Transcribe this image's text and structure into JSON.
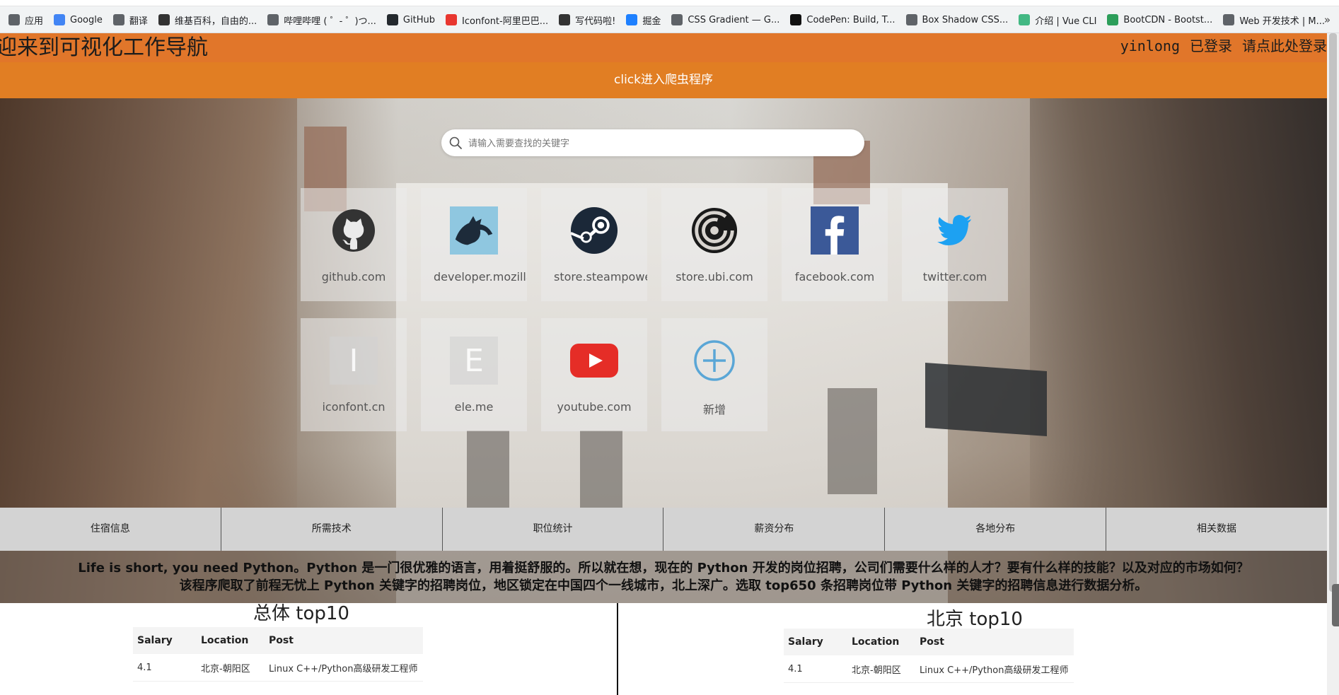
{
  "bookmarks": [
    {
      "label": "应用",
      "icon": "apps-grid-icon",
      "color": "#5f6368"
    },
    {
      "label": "Google",
      "icon": "google-icon",
      "color": "#4285f4"
    },
    {
      "label": "翻译",
      "icon": "translate-icon",
      "color": "#5f6368"
    },
    {
      "label": "维基百科，自由的...",
      "icon": "wikipedia-icon",
      "color": "#333333"
    },
    {
      "label": "哔哩哔哩 ( ゜- ゜)つ...",
      "icon": "globe-icon",
      "color": "#5f6368"
    },
    {
      "label": "GitHub",
      "icon": "github-icon",
      "color": "#24292e"
    },
    {
      "label": "Iconfont-阿里巴巴...",
      "icon": "iconfont-icon",
      "color": "#e8362f"
    },
    {
      "label": "写代码啦!",
      "icon": "code-icon",
      "color": "#333333"
    },
    {
      "label": "掘金",
      "icon": "juejin-icon",
      "color": "#1e80ff"
    },
    {
      "label": "CSS Gradient — G...",
      "icon": "globe-icon",
      "color": "#5f6368"
    },
    {
      "label": "CodePen: Build, T...",
      "icon": "codepen-icon",
      "color": "#111111"
    },
    {
      "label": "Box Shadow CSS...",
      "icon": "globe-icon",
      "color": "#5f6368"
    },
    {
      "label": "介绍 | Vue CLI",
      "icon": "vue-icon",
      "color": "#42b883"
    },
    {
      "label": "BootCDN - Bootst...",
      "icon": "bootcdn-icon",
      "color": "#2c9e5a"
    },
    {
      "label": "Web 开发技术 | M...",
      "icon": "globe-icon",
      "color": "#5f6368"
    }
  ],
  "bookmarks_more": "»",
  "header": {
    "title": "迎来到可视化工作导航",
    "user": "yinlong",
    "logged_in": "已登录",
    "login_prompt": "请点此处登录"
  },
  "crawler_link": "click进入爬虫程序",
  "search": {
    "placeholder": "请输入需要查找的关键字"
  },
  "tiles": [
    {
      "label": "github.com",
      "icon": "github-icon"
    },
    {
      "label": "developer.mozilla.org",
      "icon": "mdn-dino-icon"
    },
    {
      "label": "store.steampowered.com",
      "icon": "steam-icon"
    },
    {
      "label": "store.ubi.com",
      "icon": "ubisoft-icon"
    },
    {
      "label": "facebook.com",
      "icon": "facebook-icon"
    },
    {
      "label": "twitter.com",
      "icon": "twitter-icon"
    },
    {
      "label": "iconfont.cn",
      "icon": "iconfont-placeholder-icon",
      "letter": "I"
    },
    {
      "label": "ele.me",
      "icon": "eleme-placeholder-icon",
      "letter": "E"
    },
    {
      "label": "youtube.com",
      "icon": "youtube-icon"
    },
    {
      "label": "新增",
      "icon": "add-circle-icon"
    }
  ],
  "tabs": [
    "住宿信息",
    "所需技术",
    "职位统计",
    "薪资分布",
    "各地分布",
    "相关数据"
  ],
  "intro": {
    "line1": "Life is short, you need Python。Python 是一门很优雅的语言，用着挺舒服的。所以就在想，现在的 Python 开发的岗位招聘，公司们需要什么样的人才？要有什么样的技能？以及对应的市场如何？",
    "line2": "该程序爬取了前程无忧上 Python 关键字的招聘岗位，地区锁定在中国四个一线城市，北上深广。选取 top650 条招聘岗位带 Python 关键字的招聘信息进行数据分析。"
  },
  "left_panel": {
    "title": "总体 top10",
    "columns": [
      "Salary",
      "Location",
      "Post"
    ],
    "rows": [
      [
        "4.1",
        "北京-朝阳区",
        "Linux C++/Python高级研发工程师"
      ]
    ]
  },
  "right_panel": {
    "title": "北京 top10",
    "columns": [
      "Salary",
      "Location",
      "Post"
    ],
    "rows": [
      [
        "4.1",
        "北京-朝阳区",
        "Linux C++/Python高级研发工程师"
      ]
    ]
  }
}
